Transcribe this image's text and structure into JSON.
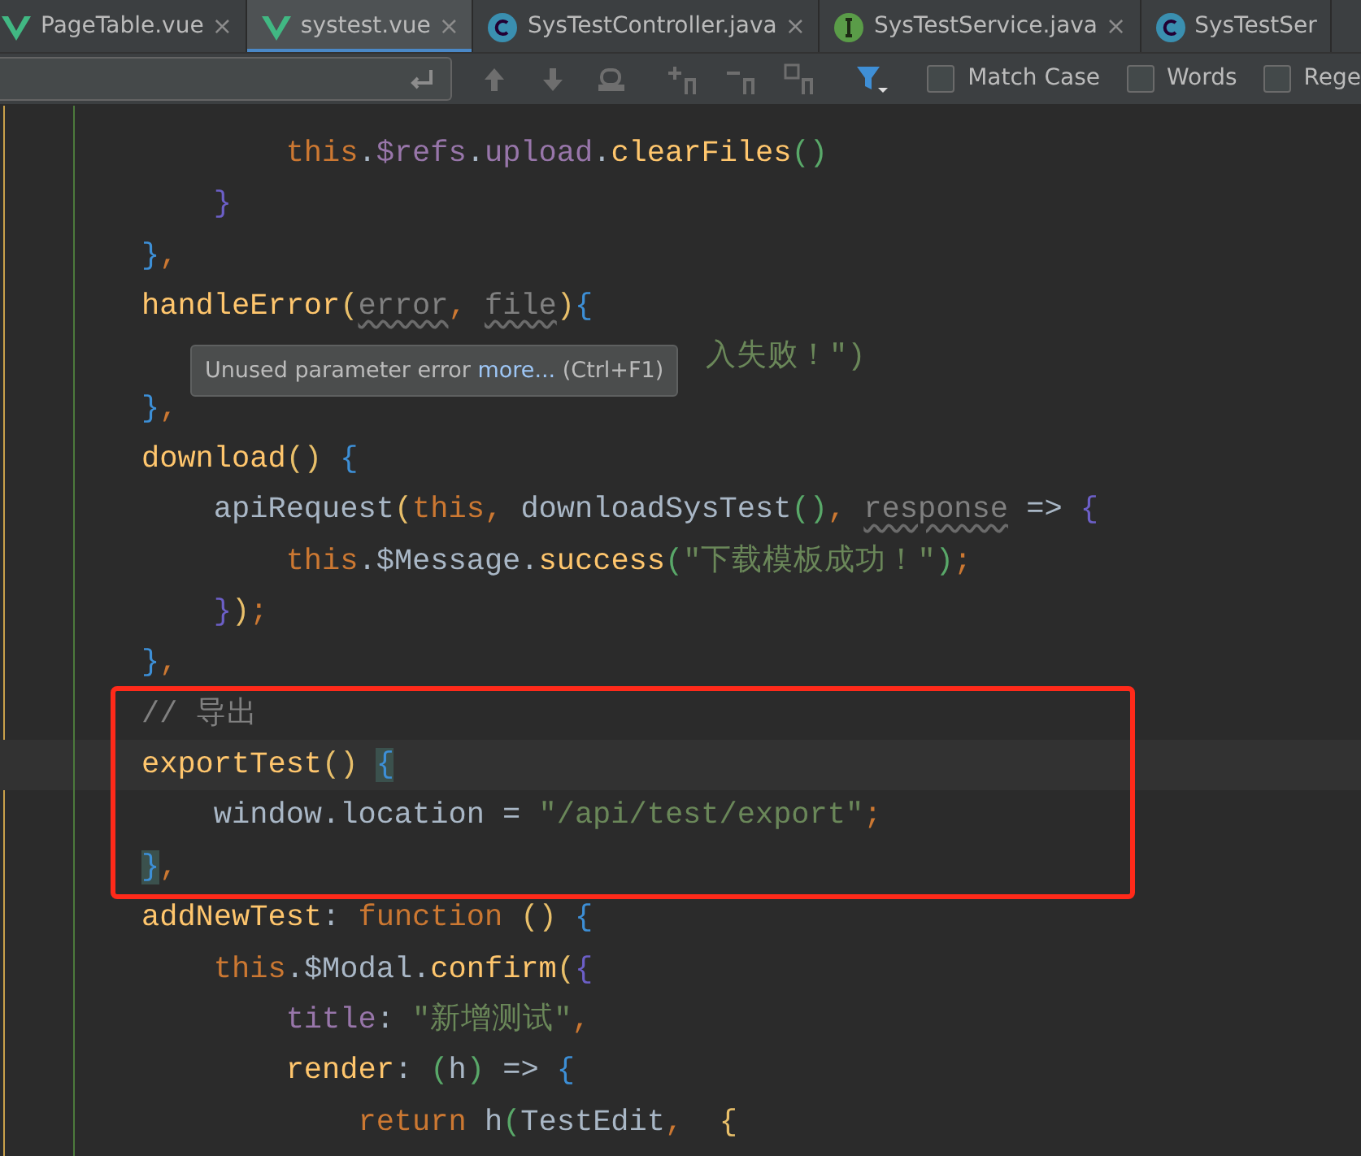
{
  "tabs": [
    {
      "label": "PageTable.vue",
      "kind": "vue",
      "selected": false,
      "close": "×"
    },
    {
      "label": "systest.vue",
      "kind": "vue",
      "selected": true,
      "close": "×"
    },
    {
      "label": "SysTestController.java",
      "kind": "class",
      "selected": false,
      "close": "×"
    },
    {
      "label": "SysTestService.java",
      "kind": "interface",
      "selected": false,
      "close": "×"
    },
    {
      "label": "SysTestSer",
      "kind": "class",
      "selected": false
    }
  ],
  "search": {
    "options": [
      {
        "label": "Match Case",
        "checked": false
      },
      {
        "label": "Words",
        "checked": false
      },
      {
        "label": "Rege",
        "checked": false
      }
    ]
  },
  "editor": {
    "lines": [
      {
        "tokens": [
          {
            "text": "        this",
            "kind": "kw"
          },
          {
            "text": ".",
            "kind": "plain"
          },
          {
            "text": "$refs",
            "kind": "prop"
          },
          {
            "text": ".",
            "kind": "plain"
          },
          {
            "text": "upload",
            "kind": "prop"
          },
          {
            "text": ".",
            "kind": "plain"
          },
          {
            "text": "clearFiles",
            "kind": "fn"
          },
          {
            "text": "()",
            "kind": "b3"
          }
        ]
      },
      {
        "tokens": [
          {
            "text": "    }",
            "kind": "b4"
          }
        ]
      },
      {
        "tokens": [
          {
            "text": "}",
            "kind": "b1"
          },
          {
            "text": ",",
            "kind": "kw"
          }
        ]
      },
      {
        "tokens": [
          {
            "text": "handleError",
            "kind": "fn"
          },
          {
            "text": "(",
            "kind": "b2"
          },
          {
            "text": "error",
            "kind": "unused"
          },
          {
            "text": ", ",
            "kind": "kw"
          },
          {
            "text": "file",
            "kind": "unused"
          },
          {
            "text": ")",
            "kind": "b2"
          },
          {
            "text": "{",
            "kind": "b1"
          }
        ]
      },
      {
        "covered": true,
        "tokens": [
          {
            "text": "入失败！\")",
            "kind": "str"
          }
        ]
      },
      {
        "tokens": [
          {
            "text": "}",
            "kind": "b1"
          },
          {
            "text": ",",
            "kind": "kw"
          }
        ]
      },
      {
        "tokens": [
          {
            "text": "download",
            "kind": "fn"
          },
          {
            "text": "()",
            "kind": "b2"
          },
          {
            "text": " {",
            "kind": "b1"
          }
        ]
      },
      {
        "tokens": [
          {
            "text": "    apiRequest",
            "kind": "plain"
          },
          {
            "text": "(",
            "kind": "b2"
          },
          {
            "text": "this",
            "kind": "kw"
          },
          {
            "text": ", ",
            "kind": "kw"
          },
          {
            "text": "downloadSysTest",
            "kind": "plain"
          },
          {
            "text": "()",
            "kind": "b3"
          },
          {
            "text": ", ",
            "kind": "kw"
          },
          {
            "text": "response",
            "kind": "unused"
          },
          {
            "text": " =>",
            "kind": "plain"
          },
          {
            "text": " {",
            "kind": "b4"
          }
        ]
      },
      {
        "tokens": [
          {
            "text": "        this",
            "kind": "kw"
          },
          {
            "text": ".",
            "kind": "plain"
          },
          {
            "text": "$Message",
            "kind": "plain"
          },
          {
            "text": ".",
            "kind": "plain"
          },
          {
            "text": "success",
            "kind": "fn"
          },
          {
            "text": "(",
            "kind": "b3"
          },
          {
            "text": "\"下载模板成功！\"",
            "kind": "str"
          },
          {
            "text": ")",
            "kind": "b3"
          },
          {
            "text": ";",
            "kind": "kw"
          }
        ]
      },
      {
        "tokens": [
          {
            "text": "    }",
            "kind": "b4"
          },
          {
            "text": ")",
            "kind": "b2"
          },
          {
            "text": ";",
            "kind": "kw"
          }
        ]
      },
      {
        "tokens": [
          {
            "text": "}",
            "kind": "b1"
          },
          {
            "text": ",",
            "kind": "kw"
          }
        ]
      },
      {
        "annotated": true,
        "tokens": [
          {
            "text": "// 导出",
            "kind": "cmt"
          }
        ]
      },
      {
        "annotated": true,
        "current": true,
        "tokens": [
          {
            "text": "exportTest",
            "kind": "fn"
          },
          {
            "text": "() ",
            "kind": "b2"
          },
          {
            "text": "{",
            "kind": "match"
          }
        ]
      },
      {
        "annotated": true,
        "tokens": [
          {
            "text": "    window.location =",
            "kind": "plain"
          },
          {
            "text": " \"/api/test/export\"",
            "kind": "str"
          },
          {
            "text": ";",
            "kind": "kw"
          }
        ]
      },
      {
        "annotated": true,
        "tokens": [
          {
            "text": "}",
            "kind": "match"
          },
          {
            "text": ",",
            "kind": "kw"
          }
        ]
      },
      {
        "tokens": [
          {
            "text": "addNewTest",
            "kind": "fn"
          },
          {
            "text": ":",
            "kind": "plain"
          },
          {
            "text": " function",
            "kind": "kw"
          },
          {
            "text": " ()",
            "kind": "b2"
          },
          {
            "text": " {",
            "kind": "b1"
          }
        ]
      },
      {
        "tokens": [
          {
            "text": "    this",
            "kind": "kw"
          },
          {
            "text": ".",
            "kind": "plain"
          },
          {
            "text": "$Modal",
            "kind": "plain"
          },
          {
            "text": ".",
            "kind": "plain"
          },
          {
            "text": "confirm",
            "kind": "fn"
          },
          {
            "text": "(",
            "kind": "b2"
          },
          {
            "text": "{",
            "kind": "b4"
          }
        ]
      },
      {
        "tokens": [
          {
            "text": "        title",
            "kind": "prop"
          },
          {
            "text": ":",
            "kind": "plain"
          },
          {
            "text": " \"新增测试\"",
            "kind": "str"
          },
          {
            "text": ",",
            "kind": "kw"
          }
        ]
      },
      {
        "tokens": [
          {
            "text": "        render",
            "kind": "fn"
          },
          {
            "text": ":",
            "kind": "plain"
          },
          {
            "text": " (",
            "kind": "b3"
          },
          {
            "text": "h",
            "kind": "plain"
          },
          {
            "text": ")",
            "kind": "b3"
          },
          {
            "text": " =>",
            "kind": "plain"
          },
          {
            "text": " {",
            "kind": "b1"
          }
        ]
      },
      {
        "tokens": [
          {
            "text": "            return",
            "kind": "kw"
          },
          {
            "text": " h",
            "kind": "plain"
          },
          {
            "text": "(",
            "kind": "b3"
          },
          {
            "text": "TestEdit",
            "kind": "plain"
          },
          {
            "text": ",",
            "kind": "kw"
          },
          {
            "text": "  {",
            "kind": "b2"
          }
        ]
      }
    ],
    "tooltip": {
      "text": "Unused parameter error",
      "link": "more...",
      "shortcut": "(Ctrl+F1)"
    }
  }
}
